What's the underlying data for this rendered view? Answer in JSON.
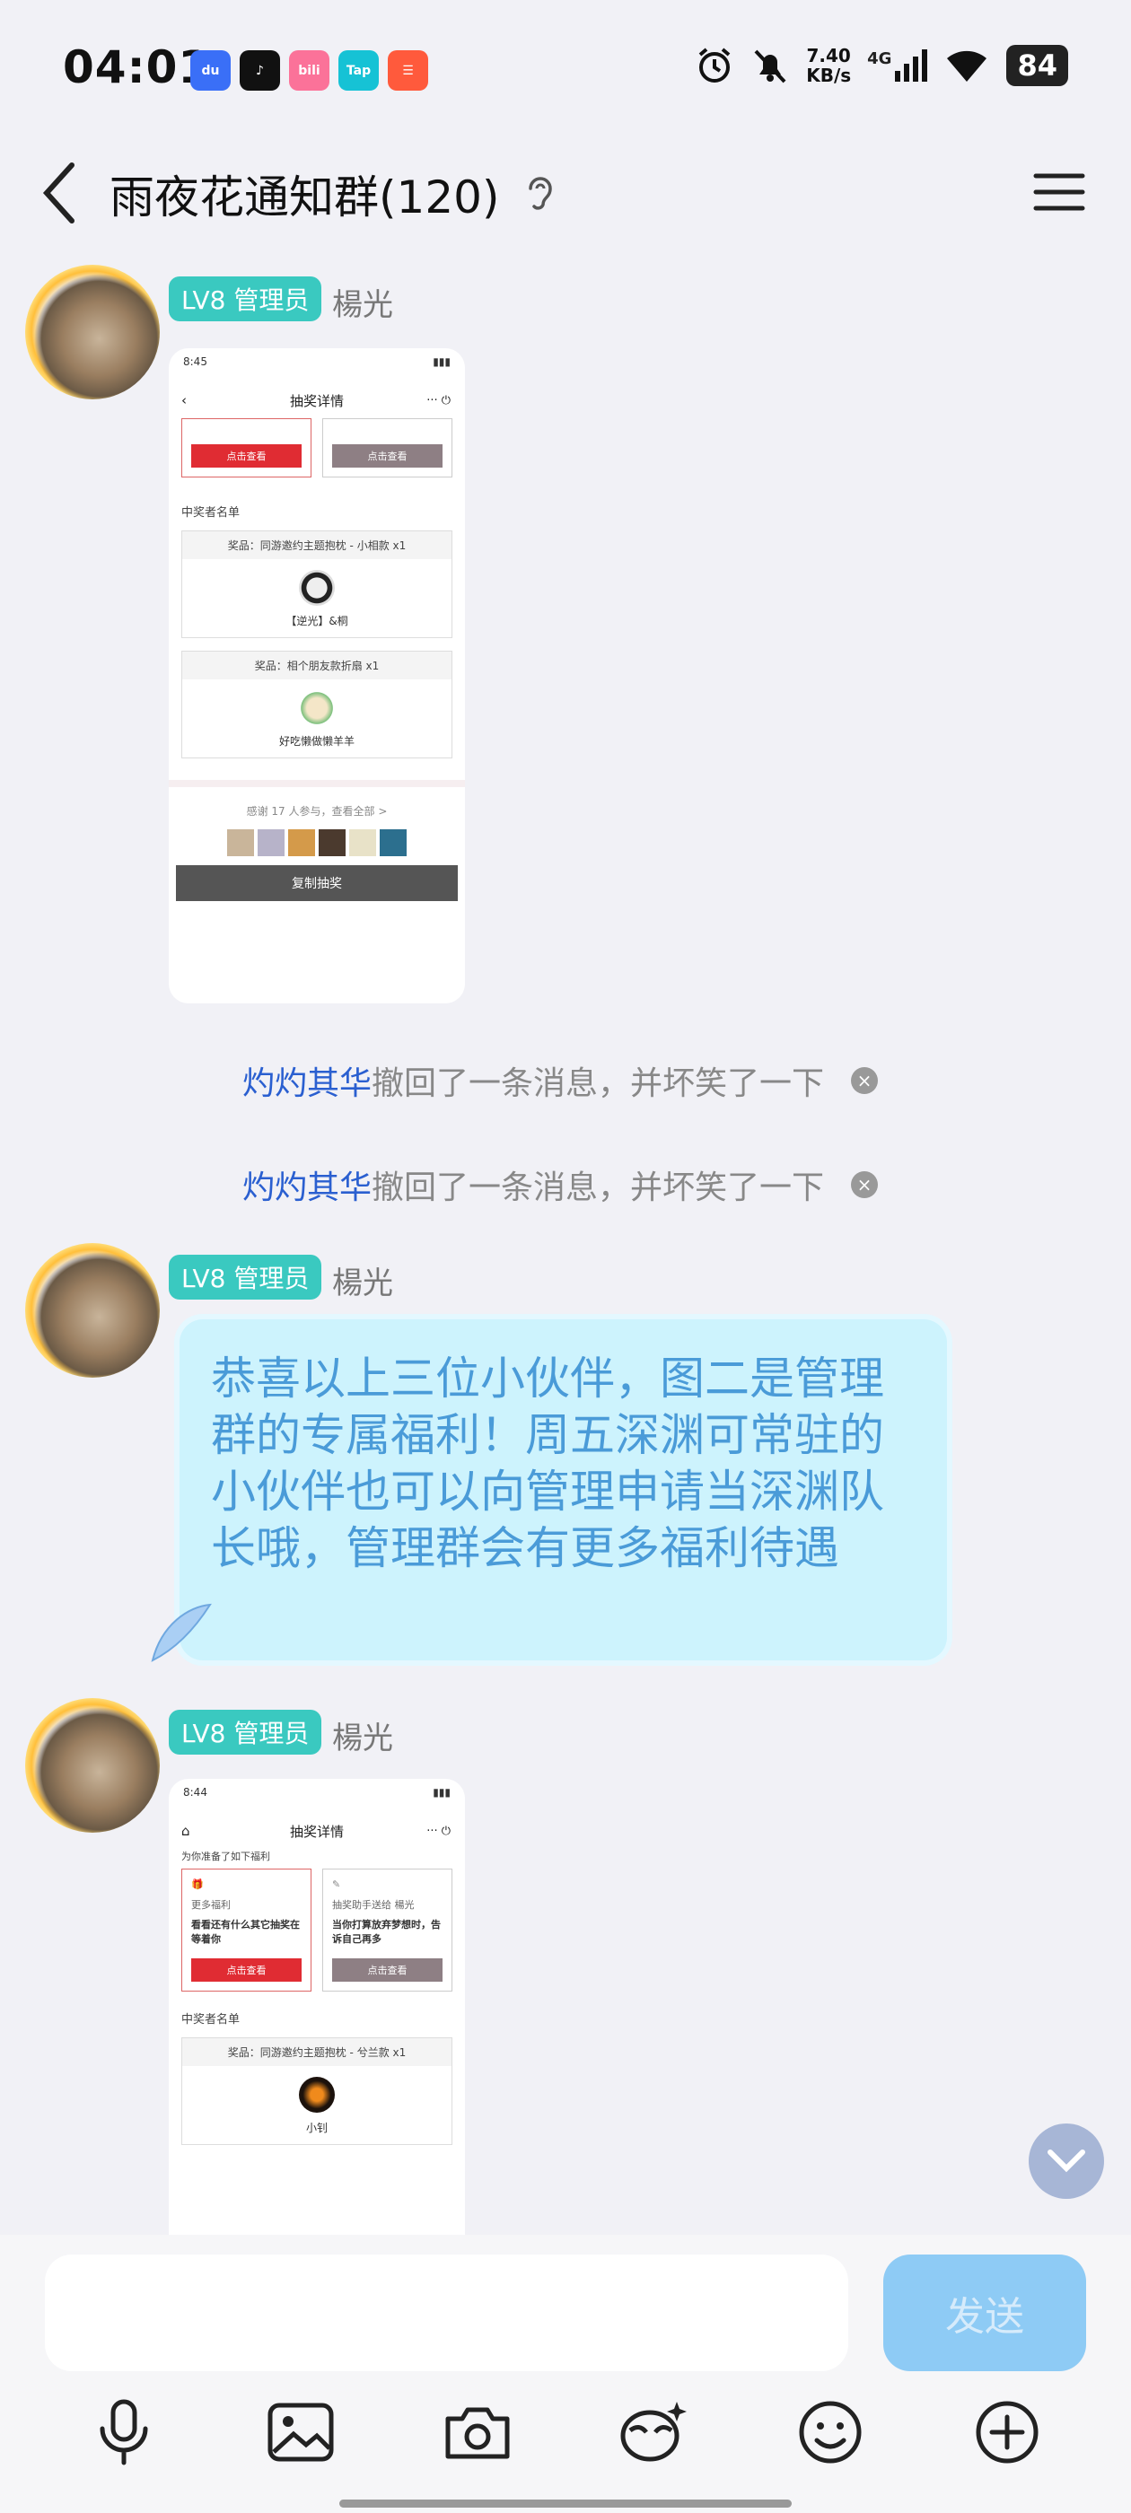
{
  "status_bar": {
    "time": "04:01",
    "net_speed_value": "7.40",
    "net_speed_unit": "KB/s",
    "network": "4G",
    "battery": "84",
    "app_icons": [
      "baidu-netdisk",
      "tiktok",
      "bilibili",
      "taptap",
      "xiaohongshu"
    ]
  },
  "header": {
    "title": "雨夜花通知群(120)"
  },
  "messages": [
    {
      "badge": "LV8 管理员",
      "sender": "楊光",
      "shot": {
        "time": "8:45",
        "nav_title": "抽奖详情",
        "btn_left": "点击查看",
        "btn_right": "点击查看",
        "section": "中奖者名单",
        "prize1_head": "奖品：同游邀约主题抱枕 - 小相款 x1",
        "prize1_winner": "【逆光】&桐",
        "prize2_head": "奖品：相个朋友款折扇 x1",
        "prize2_winner": "好吃懒做懒羊羊",
        "thanks": "感谢 17 人参与，查看全部 >",
        "copy": "复制抽奖"
      }
    },
    {
      "badge": "LV8 管理员",
      "sender": "楊光",
      "text": "恭喜以上三位小伙伴，图二是管理群的专属福利！周五深渊可常驻的小伙伴也可以向管理申请当深渊队长哦，管理群会有更多福利待遇"
    },
    {
      "badge": "LV8 管理员",
      "sender": "楊光",
      "shot": {
        "time": "8:44",
        "nav_title": "抽奖详情",
        "subtitle": "为你准备了如下福利",
        "card1_tag": "更多福利",
        "card1_text": "看看还有什么其它抽奖在等着你",
        "card1_btn": "点击查看",
        "card2_tag": "抽奖助手送给 楊光",
        "card2_text": "当你打算放弃梦想时，告诉自己再多",
        "card2_btn": "点击查看",
        "section": "中奖者名单",
        "prize1_head": "奖品：同游邀约主题抱枕 - 兮兰款 x1",
        "prize1_winner": "小钊"
      }
    }
  ],
  "recalls": [
    {
      "who": "灼灼其华",
      "text": "撤回了一条消息，并坏笑了一下"
    },
    {
      "who": "灼灼其华",
      "text": "撤回了一条消息，并坏笑了一下"
    }
  ],
  "input": {
    "send_label": "发送"
  },
  "colors": {
    "badge": "#3ac9c0",
    "bubble": "#cdf3fd",
    "bubble_text": "#4a9bd8",
    "send": "#8ecbf5",
    "recall_name": "#2a5fd0"
  }
}
